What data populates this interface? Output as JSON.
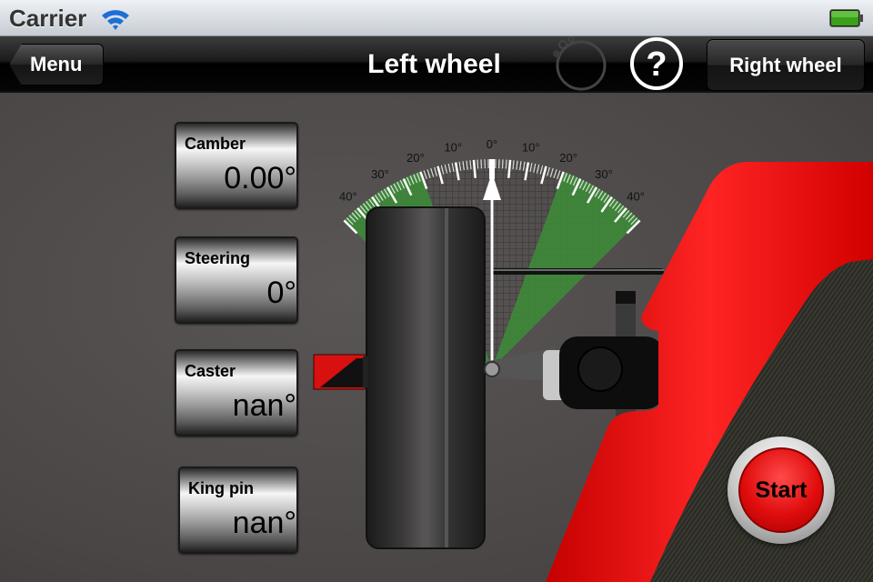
{
  "status_bar": {
    "carrier": "Carrier",
    "wifi_icon": "wifi-icon",
    "battery_icon": "battery-full-icon",
    "battery_color": "#3aa01a"
  },
  "nav": {
    "back_label": "Menu",
    "title": "Left wheel",
    "right_label": "Right wheel",
    "spinner_icon": "activity-spinner-icon",
    "help_icon": "help-question-icon"
  },
  "readouts": [
    {
      "label": "Camber",
      "value": "0.00°"
    },
    {
      "label": "Steering",
      "value": "0°"
    },
    {
      "label": "Caster",
      "value": "nan°"
    },
    {
      "label": "King pin",
      "value": "nan°"
    }
  ],
  "gauge": {
    "tick_labels": [
      "40°",
      "30°",
      "20°",
      "10°",
      "0°",
      "10°",
      "20°",
      "30°",
      "40°"
    ],
    "range_deg": [
      -45,
      45
    ],
    "highlight_bands_deg": [
      [
        -45,
        -20
      ],
      [
        20,
        45
      ]
    ],
    "pointer_deg": 0,
    "highlight_color": "#3e8a3a"
  },
  "actions": {
    "start_label": "Start",
    "accent_color": "#e00d0d"
  }
}
